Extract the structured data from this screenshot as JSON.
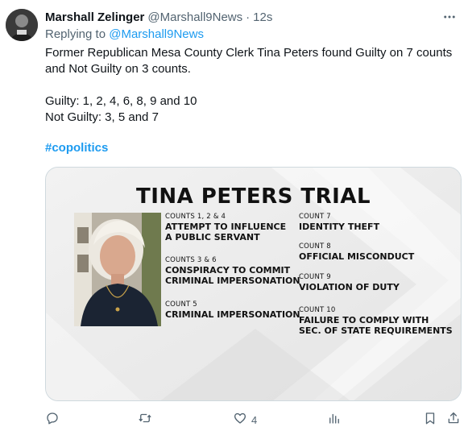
{
  "author": {
    "name": "Marshall Zelinger",
    "handle": "@Marshall9News",
    "separator": "·",
    "time": "12s"
  },
  "reply": {
    "prefix": "Replying to",
    "handle": "@Marshall9News"
  },
  "tweet": {
    "line1": "Former Republican Mesa County Clerk Tina Peters found Guilty on 7 counts and Not Guilty on 3 counts.",
    "guilty": "Guilty: 1, 2, 4, 6, 8, 9 and 10",
    "not_guilty": "Not Guilty: 3, 5 and 7",
    "hashtag": "#copolitics"
  },
  "graphic": {
    "title": "TINA PETERS TRIAL",
    "counts": [
      {
        "label": "COUNTS 1, 2 & 4",
        "title_line1": "ATTEMPT TO INFLUENCE",
        "title_line2": "A PUBLIC SERVANT"
      },
      {
        "label": "COUNTS 3 & 6",
        "title_line1": "CONSPIRACY TO COMMIT",
        "title_line2": "CRIMINAL IMPERSONATION"
      },
      {
        "label": "COUNT 5",
        "title_line1": "CRIMINAL IMPERSONATION",
        "title_line2": ""
      },
      {
        "label": "COUNT 7",
        "title_line1": "IDENTITY THEFT",
        "title_line2": ""
      },
      {
        "label": "COUNT 8",
        "title_line1": "OFFICIAL MISCONDUCT",
        "title_line2": ""
      },
      {
        "label": "COUNT 9",
        "title_line1": "VIOLATION OF DUTY",
        "title_line2": ""
      },
      {
        "label": "COUNT 10",
        "title_line1": "FAILURE TO COMPLY WITH",
        "title_line2": "SEC. OF STATE REQUIREMENTS"
      }
    ]
  },
  "actions": {
    "reply_count": "",
    "retweet_count": "",
    "like_count": "4",
    "views_count": ""
  },
  "icons": {
    "more": "more-icon",
    "reply": "reply-icon",
    "retweet": "retweet-icon",
    "like": "heart-icon",
    "views": "views-icon",
    "bookmark": "bookmark-icon",
    "share": "share-icon"
  },
  "colors": {
    "link": "#1d9bf0",
    "secondary_text": "#536471",
    "primary_text": "#0f1419"
  }
}
